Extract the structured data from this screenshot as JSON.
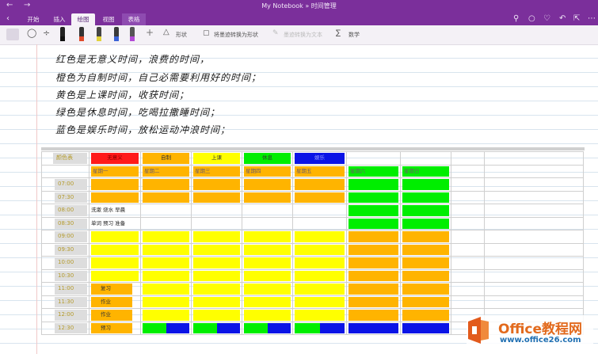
{
  "titlebar": {
    "title": "My Notebook » 时间管理"
  },
  "ribbon": {
    "tabs": [
      {
        "label": "开始",
        "active": false
      },
      {
        "label": "插入",
        "active": false
      },
      {
        "label": "绘图",
        "active": true
      },
      {
        "label": "视图",
        "active": false
      },
      {
        "label": "表格",
        "active": false
      }
    ],
    "right_icons": [
      "search-icon",
      "lightbulb-icon",
      "bell-icon",
      "undo-icon",
      "share-icon",
      "more-icon"
    ]
  },
  "toolbar": {
    "shapes_label": "形状",
    "convert_label": "将墨迹转换为形状",
    "ink_text_label": "墨迹转换为文本",
    "math_label": "数学",
    "pen_colors": [
      "#111111",
      "#e04a2a",
      "#e2d23a",
      "#3a62d6",
      "#b24ad6"
    ]
  },
  "notes": [
    "红色是无意义时间，浪费的时间，",
    "橙色为自制时间，自己必需要利用好的时间；",
    "黄色是上课时间，收获时间；",
    "绿色是休息时间，吃喝拉撒睡时间；",
    "蓝色是娱乐时间，放松运动冲浪时间；"
  ],
  "colors": {
    "red": "#ff1a1a",
    "orange": "#ffb400",
    "yellow": "#ffff00",
    "green": "#00ee00",
    "blue": "#0a14e6"
  },
  "schedule": {
    "corner": "颜色表",
    "legend": [
      {
        "label": "无意义",
        "color": "red"
      },
      {
        "label": "自制",
        "color": "orange"
      },
      {
        "label": "上课",
        "color": "yellow"
      },
      {
        "label": "休息",
        "color": "green"
      },
      {
        "label": "娱乐",
        "color": "blue"
      }
    ],
    "days": [
      "星期一",
      "星期二",
      "星期三",
      "星期四",
      "星期五",
      "星期六",
      "星期日"
    ],
    "rows": [
      {
        "time": "07:00",
        "cells": [
          "orange",
          "orange",
          "orange",
          "orange",
          "orange",
          "green",
          "green"
        ]
      },
      {
        "time": "07:30",
        "cells": [
          "orange",
          "orange",
          "orange",
          "orange",
          "orange",
          "green",
          "green"
        ]
      },
      {
        "time": "08:00",
        "cells": [
          "text:洗漱 烧水 早晨",
          "",
          "",
          "",
          "",
          "green",
          "green"
        ]
      },
      {
        "time": "08:30",
        "cells": [
          "text:单词 预习 准备",
          "",
          "",
          "",
          "",
          "green",
          "green"
        ]
      },
      {
        "time": "09:00",
        "cells": [
          "yellow",
          "yellow",
          "yellow",
          "yellow",
          "yellow",
          "orange",
          "orange"
        ]
      },
      {
        "time": "09:30",
        "cells": [
          "yellow",
          "yellow",
          "yellow",
          "yellow",
          "yellow",
          "orange",
          "orange"
        ]
      },
      {
        "time": "10:00",
        "cells": [
          "yellow",
          "yellow",
          "yellow",
          "yellow",
          "yellow",
          "orange",
          "orange"
        ]
      },
      {
        "time": "10:30",
        "cells": [
          "yellow",
          "yellow",
          "yellow",
          "yellow",
          "yellow",
          "orange",
          "orange"
        ]
      },
      {
        "time": "11:00",
        "cells": [
          "orange:复习",
          "yellow",
          "yellow",
          "yellow",
          "yellow",
          "orange",
          "orange"
        ]
      },
      {
        "time": "11:30",
        "cells": [
          "orange:作业",
          "yellow",
          "yellow",
          "yellow",
          "yellow",
          "orange",
          "orange"
        ]
      },
      {
        "time": "12:00",
        "cells": [
          "orange:作业",
          "yellow",
          "yellow",
          "yellow",
          "yellow",
          "orange",
          "orange"
        ]
      },
      {
        "time": "12:30",
        "cells": [
          "orange:预习",
          "split",
          "split",
          "split",
          "split",
          "blue",
          "blue"
        ]
      }
    ]
  },
  "watermark": {
    "brand": "Office教程网",
    "url": "www.office26.com"
  }
}
